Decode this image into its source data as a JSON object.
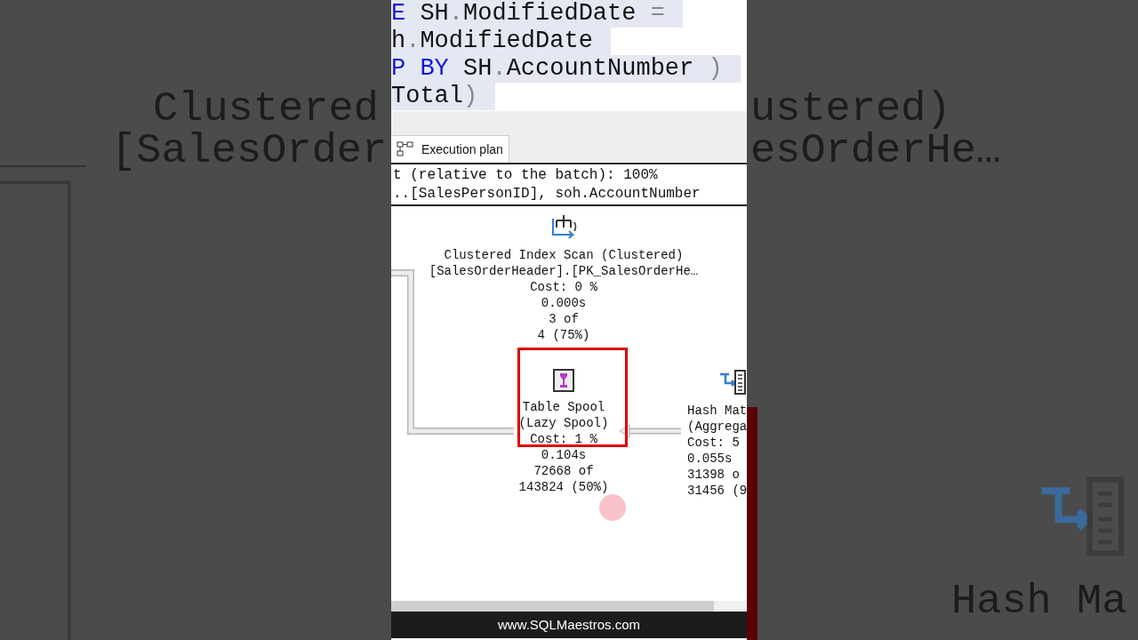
{
  "backdrop_left": {
    "lines": [
      "Clustered",
      "[SalesOrder"
    ]
  },
  "backdrop_right": {
    "lines": [
      "ustered)",
      "esOrderHe…"
    ],
    "node_label": "Hash Ma"
  },
  "editor": {
    "lines": [
      {
        "tokens": [
          {
            "text": "E",
            "kind": "keyword"
          },
          {
            "text": " SH",
            "kind": "plain"
          },
          {
            "text": ".",
            "kind": "operator"
          },
          {
            "text": "ModifiedDate ",
            "kind": "plain"
          },
          {
            "text": "=",
            "kind": "operator"
          }
        ]
      },
      {
        "tokens": [
          {
            "text": "h",
            "kind": "plain"
          },
          {
            "text": ".",
            "kind": "operator"
          },
          {
            "text": "ModifiedDate",
            "kind": "plain"
          }
        ]
      },
      {
        "tokens": [
          {
            "text": "P BY",
            "kind": "keyword"
          },
          {
            "text": " SH",
            "kind": "plain"
          },
          {
            "text": ".",
            "kind": "operator"
          },
          {
            "text": "AccountNumber ",
            "kind": "plain"
          },
          {
            "text": ")",
            "kind": "operator"
          }
        ]
      },
      {
        "tokens": [
          {
            "text": "Total",
            "kind": "plain"
          },
          {
            "text": ")",
            "kind": "operator"
          }
        ]
      }
    ]
  },
  "results_tab": {
    "label": "Execution plan",
    "selected": true
  },
  "plan_header": [
    "t (relative to the batch): 100%",
    "..[SalesPersonID], soh.AccountNumber"
  ],
  "nodes": [
    {
      "kind": "clustered_index_scan",
      "highlighted": false,
      "lines": [
        "Clustered Index Scan (Clustered)",
        "[SalesOrderHeader].[PK_SalesOrderHe…",
        "Cost: 0 %",
        "0.000s",
        "3 of",
        "4 (75%)"
      ]
    },
    {
      "kind": "table_spool",
      "highlighted": true,
      "lines": [
        "Table Spool",
        "(Lazy Spool)",
        "Cost: 1 %",
        "0.104s",
        "72668 of",
        "143824 (50%)"
      ]
    },
    {
      "kind": "hash_match",
      "highlighted": false,
      "lines": [
        "Hash Mat",
        "(Aggrega",
        "Cost: 5",
        "0.055s",
        "31398 o",
        "31456 (9"
      ]
    }
  ],
  "footer": "www.SQLMaestros.com"
}
